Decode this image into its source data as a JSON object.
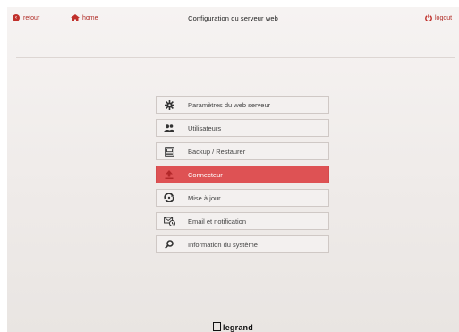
{
  "header": {
    "back_label": "retour",
    "home_label": "home",
    "title": "Configuration du serveur web",
    "logout_label": "logout"
  },
  "menu": {
    "items": [
      {
        "label": "Paramètres du web serveur",
        "icon": "gear-icon"
      },
      {
        "label": "Utilisateurs",
        "icon": "users-icon"
      },
      {
        "label": "Backup / Restaurer",
        "icon": "backup-icon"
      },
      {
        "label": "Connecteur",
        "icon": "upload-icon",
        "active": true
      },
      {
        "label": "Mise à jour",
        "icon": "update-icon"
      },
      {
        "label": "Email et notification",
        "icon": "email-icon"
      },
      {
        "label": "Information du système",
        "icon": "search-icon"
      }
    ]
  },
  "footer": {
    "brand": "legrand"
  },
  "colors": {
    "accent": "#c0302b",
    "active_row": "#de5254"
  }
}
